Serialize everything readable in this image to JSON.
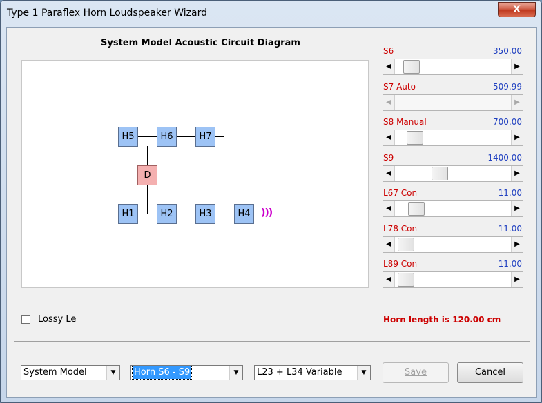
{
  "window": {
    "title": "Type 1 Paraflex Horn Loudspeaker Wizard",
    "close_glyph": "X"
  },
  "diagram": {
    "title": "System Model Acoustic Circuit Diagram",
    "nodes": {
      "h5": "H5",
      "h6": "H6",
      "h7": "H7",
      "d": "D",
      "h1": "H1",
      "h2": "H2",
      "h3": "H3",
      "h4": "H4"
    },
    "sound_waves": ")))",
    "colors": {
      "horn_node": "#9dc3f5",
      "driver_node": "#f4b0b0",
      "waves": "#cc00cc"
    }
  },
  "params": [
    {
      "name": "S6",
      "value": "350.00",
      "thumb_fraction": 0.08,
      "enabled": true
    },
    {
      "name": "S7  Auto",
      "value": "509.99",
      "thumb_fraction": null,
      "enabled": false
    },
    {
      "name": "S8  Manual",
      "value": "700.00",
      "thumb_fraction": 0.12,
      "enabled": true
    },
    {
      "name": "S9",
      "value": "1400.00",
      "thumb_fraction": 0.37,
      "enabled": true
    },
    {
      "name": "L67  Con",
      "value": "11.00",
      "thumb_fraction": 0.13,
      "enabled": true
    },
    {
      "name": "L78  Con",
      "value": "11.00",
      "thumb_fraction": 0.03,
      "enabled": true
    },
    {
      "name": "L89  Con",
      "value": "11.00",
      "thumb_fraction": 0.03,
      "enabled": true
    }
  ],
  "scroll_arrows": {
    "left": "◀",
    "right": "▶"
  },
  "options": {
    "lossy_label": "Lossy Le",
    "lossy_checked": false
  },
  "status": {
    "horn_length": "Horn length is 120.00 cm",
    "color": "#cc0000"
  },
  "footer": {
    "model_select": "System Model",
    "horn_select": "Horn S6 - S9",
    "length_select": "L23 + L34 Variable",
    "dropdown_glyph": "▼",
    "save_label": "Save",
    "cancel_label": "Cancel"
  }
}
